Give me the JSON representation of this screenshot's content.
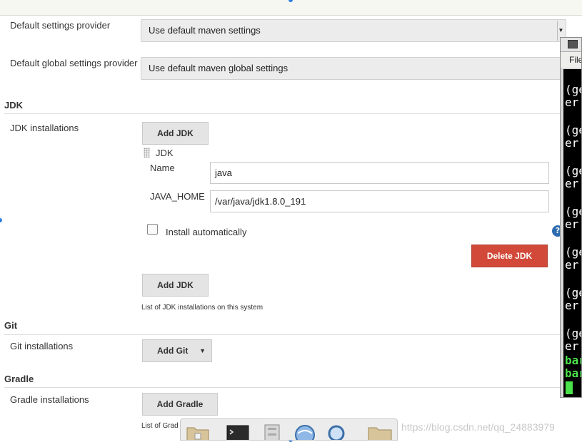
{
  "maven": {
    "settings_label": "Default settings provider",
    "settings_value": "Use default maven settings",
    "global_settings_label": "Default global settings provider",
    "global_settings_value": "Use default maven global settings"
  },
  "jdk": {
    "section_title": "JDK",
    "installations_label": "JDK installations",
    "add_button": "Add JDK",
    "item_header": "JDK",
    "name_label": "Name",
    "name_value": "java",
    "java_home_label": "JAVA_HOME",
    "java_home_value": "/var/java/jdk1.8.0_191",
    "install_auto_label": "Install automatically",
    "install_auto_checked": false,
    "help_icon": "?",
    "delete_button": "Delete JDK",
    "add_button_bottom": "Add JDK",
    "list_note": "List of JDK installations on this system"
  },
  "git": {
    "section_title": "Git",
    "installations_label": "Git installations",
    "add_button": "Add Git"
  },
  "gradle": {
    "section_title": "Gradle",
    "installations_label": "Gradle installations",
    "add_button": "Add Gradle",
    "list_note_partial": "List of Grad"
  },
  "terminal": {
    "menu_partial": "File",
    "lines": [
      "(ge",
      "er",
      "(ge",
      "er",
      "(ge",
      "er",
      "(ge",
      "er",
      "(ge",
      "er",
      "(ge",
      "er",
      "(ge",
      "er"
    ],
    "prompt_lines": [
      "bar",
      "bar"
    ]
  },
  "dock": {
    "icons": [
      "home-folder-icon",
      "terminal-icon",
      "file-cabinet-icon",
      "web-browser-icon",
      "search-magnifier-icon",
      "folder-icon"
    ]
  },
  "watermark": "https://blog.csdn.net/qq_24883979",
  "colors": {
    "danger": "#d24939",
    "help": "#2d6bb0",
    "terminal_green": "#4ae24a"
  }
}
